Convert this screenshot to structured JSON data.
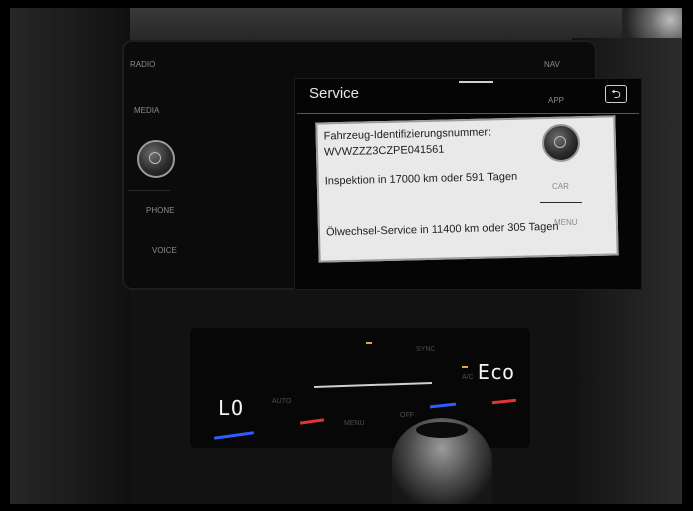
{
  "infotainment": {
    "title": "Service",
    "back_icon": "back-arrow-icon",
    "left_buttons": [
      "RADIO",
      "MEDIA",
      "PHONE",
      "VOICE"
    ],
    "right_buttons": [
      "NAV",
      "APP",
      "CAR",
      "MENU"
    ]
  },
  "service_info": {
    "vin_label": "Fahrzeug-Identifizierungsnummer:",
    "vin": "WVWZZZ3CZPE041561",
    "inspection": "Inspektion in 17000 km oder 591 Tagen",
    "oil_service": "Ölwechsel-Service in 11400 km oder 305 Tagen"
  },
  "climate": {
    "left_temp": "LO",
    "mode": "Eco",
    "labels": {
      "auto": "AUTO",
      "sync": "SYNC",
      "menu": "MENU",
      "off": "OFF",
      "ac": "A/C"
    }
  },
  "colors": {
    "accent_blue": "#3b56a8",
    "cold_blue": "#2f5cff",
    "warm_red": "#e03535",
    "indicator_amber": "#e2a53c"
  }
}
